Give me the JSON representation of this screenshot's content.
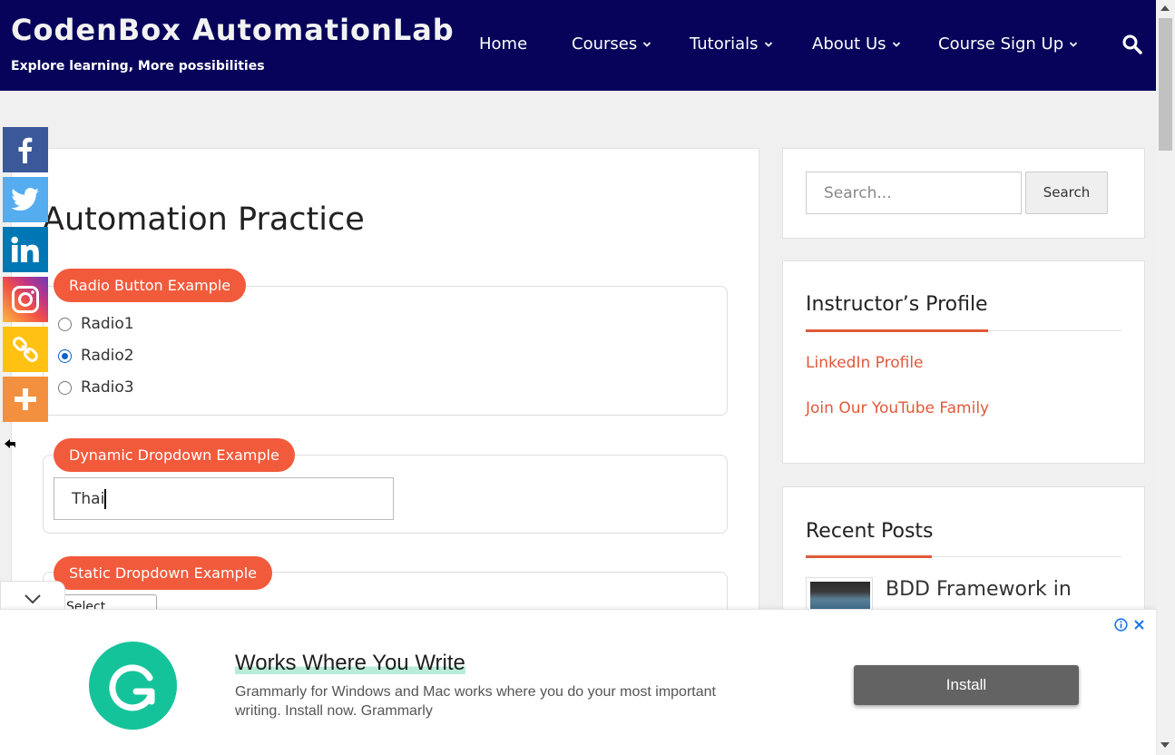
{
  "header": {
    "site_title": "CodenBox AutomationLab",
    "tagline": "Explore learning, More possibilities",
    "nav": [
      {
        "label": "Home",
        "has_dropdown": false
      },
      {
        "label": "Courses",
        "has_dropdown": true
      },
      {
        "label": "Tutorials",
        "has_dropdown": true
      },
      {
        "label": "About Us",
        "has_dropdown": true
      },
      {
        "label": "Course Sign Up",
        "has_dropdown": true
      }
    ],
    "search_icon": "search-icon",
    "bg_color": "#07035a"
  },
  "social_bar": [
    {
      "name": "facebook-icon",
      "color": "#3b5998"
    },
    {
      "name": "twitter-icon",
      "color": "#55acee"
    },
    {
      "name": "linkedin-icon",
      "color": "#0077b5"
    },
    {
      "name": "instagram-icon",
      "color": "#c13584"
    },
    {
      "name": "copy-link-icon",
      "color": "#ffc112"
    },
    {
      "name": "more-icon",
      "color": "#f3903f"
    }
  ],
  "main": {
    "page_title": "Automation Practice",
    "radio_section": {
      "legend": "Radio Button Example",
      "options": [
        {
          "label": "Radio1",
          "checked": false
        },
        {
          "label": "Radio2",
          "checked": true
        },
        {
          "label": "Radio3",
          "checked": false
        }
      ]
    },
    "dynamic_dropdown": {
      "legend": "Dynamic Dropdown Example",
      "value": "Thai"
    },
    "static_dropdown": {
      "legend": "Static Dropdown Example",
      "selected": "Select"
    },
    "accent_color": "#f25a3c"
  },
  "sidebar": {
    "search": {
      "placeholder": "Search...",
      "button_label": "Search"
    },
    "instructor": {
      "title": "Instructor’s Profile",
      "links": [
        "LinkedIn Profile",
        "Join Our YouTube Family"
      ]
    },
    "recent_posts": {
      "title": "Recent Posts",
      "posts": [
        {
          "title": "BDD Framework in"
        }
      ]
    },
    "link_color": "#e0583a"
  },
  "ad": {
    "title": "Works Where You Write",
    "body": "Grammarly for Windows and Mac works where you do your most important writing. Install now. Grammarly",
    "button_label": "Install",
    "logo_color": "#15c39a"
  }
}
